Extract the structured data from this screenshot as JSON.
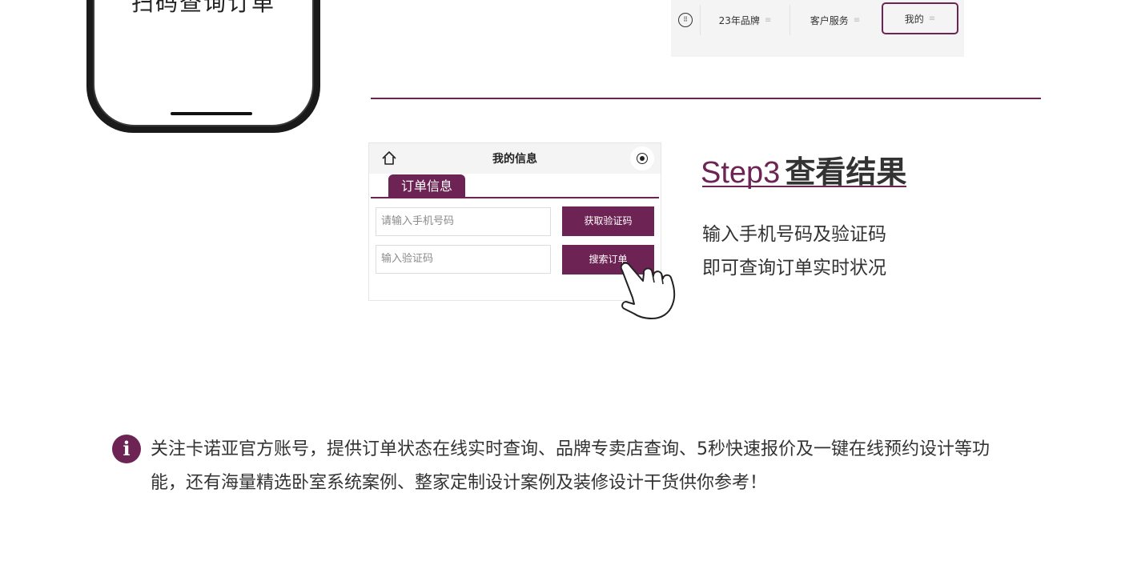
{
  "phone": {
    "caption": "扫码查询订单"
  },
  "tabbar": {
    "keyboard_icon": "keyboard-icon",
    "tabs": [
      {
        "label": "23年品牌",
        "icon": "menu-icon"
      },
      {
        "label": "客户服务",
        "icon": "menu-icon"
      },
      {
        "label": "我的",
        "icon": "menu-icon",
        "highlighted": true
      }
    ]
  },
  "order_screen": {
    "title": "我的信息",
    "tab_label": "订单信息",
    "phone_placeholder": "请输入手机号码",
    "code_placeholder": "输入验证码",
    "get_code_label": "获取验证码",
    "search_label": "搜索订单"
  },
  "step3": {
    "prefix": "Step3",
    "name": "查看结果",
    "lines": [
      "输入手机号码及验证码",
      "即可查询订单实时状况"
    ]
  },
  "note": {
    "icon": "i",
    "text": "关注卡诺亚官方账号，提供订单状态在线实时查询、品牌专卖店查询、5秒快速报价及一键在线预约设计等功能，还有海量精选卧室系统案例、整家定制设计案例及装修设计干货供你参考！"
  },
  "colors": {
    "accent": "#6d2454",
    "text": "#333333",
    "tabbar_bg": "#f4f4f4"
  }
}
